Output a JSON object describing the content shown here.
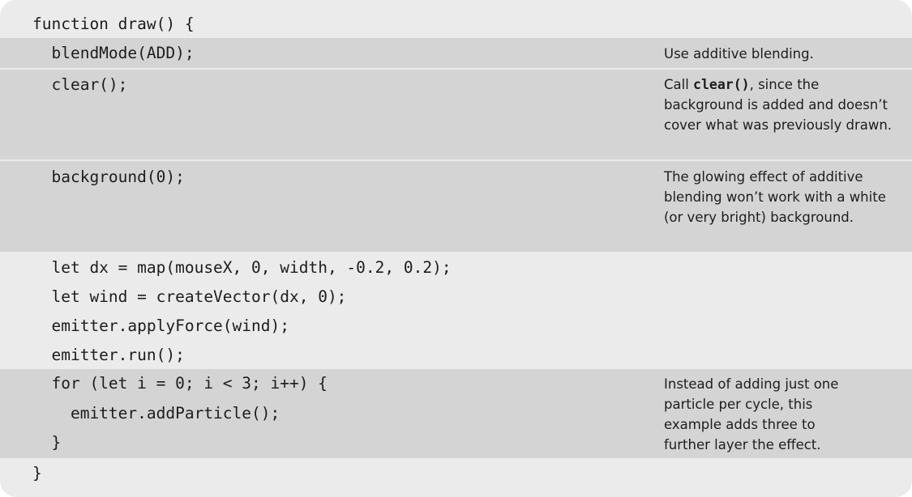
{
  "code_lines": [
    "function draw() {",
    "  blendMode(ADD);",
    "  clear();",
    "  background(0);",
    "  let dx = map(mouseX, 0, width, -0.2, 0.2);",
    "  let wind = createVector(dx, 0);",
    "  emitter.applyForce(wind);",
    "  emitter.run();",
    "  for (let i = 0; i < 3; i++) {",
    "    emitter.addParticle();",
    "  }",
    "}"
  ],
  "annotations": {
    "blendmode": "Use additive blending.",
    "clear_prefix": "Call ",
    "clear_code": "clear()",
    "clear_suffix": ", since the background is added and doesn’t cover what was previously drawn.",
    "background": "The glowing effect of additive blending won’t work with a white (or very bright) background.",
    "loop": "Instead of adding just one particle per cycle, this example adds three to further layer the effect."
  }
}
